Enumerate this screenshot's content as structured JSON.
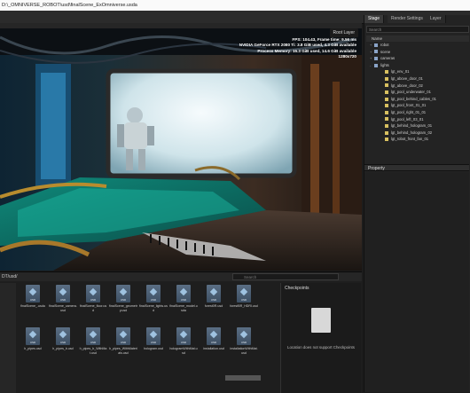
{
  "window": {
    "title": "D:\\_OMNIVERSE_ROBOT\\usd\\finalScene_ExOmniverse.usda"
  },
  "viewport": {
    "root_layer_label": "Root Layer",
    "hud": [
      "FPS: 104.43, Frame time: 9.56 ms",
      "NVIDIA GeForce RTX 2080 Ti: 3.8 GiB used, 4.3 GiB available",
      "Process Memory: 15.3 GiB used, 14.6 GiB available",
      "1280x720"
    ]
  },
  "right_panel": {
    "tabs": [
      "Stage",
      "Render Settings",
      "Layer"
    ],
    "search_placeholder": "Search",
    "tree_header": "Name",
    "tree_items": [
      {
        "label": "robot",
        "kind": "xform",
        "expand": "+"
      },
      {
        "label": "scene",
        "kind": "xform",
        "expand": "+"
      },
      {
        "label": "cameras",
        "kind": "xform",
        "expand": "+"
      },
      {
        "label": "lights",
        "kind": "xform",
        "expand": "-"
      },
      {
        "label": "lgt_env_01",
        "kind": "light",
        "expand": ""
      },
      {
        "label": "lgt_above_door_01",
        "kind": "light",
        "expand": ""
      },
      {
        "label": "lgt_above_door_02",
        "kind": "light",
        "expand": ""
      },
      {
        "label": "lgt_pool_underwater_01",
        "kind": "light",
        "expand": ""
      },
      {
        "label": "lgt_pool_behind_cables_01",
        "kind": "light",
        "expand": ""
      },
      {
        "label": "lgt_pool_front_01_01",
        "kind": "light",
        "expand": ""
      },
      {
        "label": "lgt_pool_right_01_01",
        "kind": "light",
        "expand": ""
      },
      {
        "label": "lgt_pool_left_03_01",
        "kind": "light",
        "expand": ""
      },
      {
        "label": "lgt_behind_hologram_01",
        "kind": "light",
        "expand": ""
      },
      {
        "label": "lgt_behind_hologram_02",
        "kind": "light",
        "expand": ""
      },
      {
        "label": "lgt_robot_front_fan_01",
        "kind": "light",
        "expand": ""
      }
    ],
    "property_tab": "Property"
  },
  "content_browser": {
    "path": "DT/usd/",
    "search_placeholder": "Search",
    "files_row1": [
      "finalScene_.usda",
      "finalScene_camera.usd",
      "finalScene_floor.usd",
      "finalScene_geometry.usd",
      "finalScene_lights.usd",
      "finalScene_model.usda",
      "forest0R.usd",
      "forestBR_HDRI.usd"
    ],
    "files_row2": [
      "h_pipes.usd",
      "h_pipes_b.usd",
      "h_pipes_b_WithMat.usd",
      "h_pipes_WithMaterials.usd",
      "hologram.usd",
      "hologramWithMat.usd",
      "installation.usd",
      "installationWithMat.usd"
    ],
    "usd_badge": "USD",
    "checkpoints": {
      "title": "Checkpoints",
      "message": "Location does not support Checkpoints"
    }
  },
  "colors": {
    "accent": "#e0b93e",
    "light_icon": "#d8c060",
    "xform_icon": "#8aa4c8"
  }
}
